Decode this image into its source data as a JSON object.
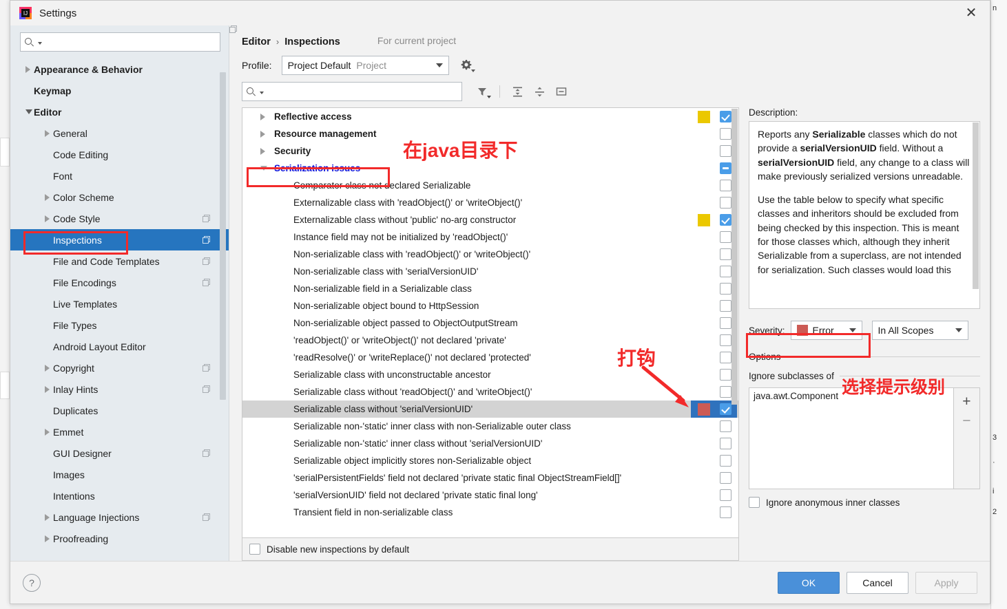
{
  "window": {
    "title": "Settings",
    "close_label": "✕"
  },
  "sidebar": {
    "search_placeholder": "",
    "search_value": "",
    "items": [
      {
        "label": "Appearance & Behavior",
        "level": 0,
        "arrow": "right",
        "copy": false,
        "selected": false
      },
      {
        "label": "Keymap",
        "level": 0,
        "arrow": "none",
        "copy": false,
        "selected": false
      },
      {
        "label": "Editor",
        "level": 0,
        "arrow": "down",
        "copy": false,
        "selected": false
      },
      {
        "label": "General",
        "level": 1,
        "arrow": "right",
        "copy": false,
        "selected": false
      },
      {
        "label": "Code Editing",
        "level": 1,
        "arrow": "none",
        "copy": false,
        "selected": false
      },
      {
        "label": "Font",
        "level": 1,
        "arrow": "none",
        "copy": false,
        "selected": false
      },
      {
        "label": "Color Scheme",
        "level": 1,
        "arrow": "right",
        "copy": false,
        "selected": false
      },
      {
        "label": "Code Style",
        "level": 1,
        "arrow": "right",
        "copy": true,
        "selected": false
      },
      {
        "label": "Inspections",
        "level": 1,
        "arrow": "none",
        "copy": true,
        "selected": true
      },
      {
        "label": "File and Code Templates",
        "level": 1,
        "arrow": "none",
        "copy": true,
        "selected": false
      },
      {
        "label": "File Encodings",
        "level": 1,
        "arrow": "none",
        "copy": true,
        "selected": false
      },
      {
        "label": "Live Templates",
        "level": 1,
        "arrow": "none",
        "copy": false,
        "selected": false
      },
      {
        "label": "File Types",
        "level": 1,
        "arrow": "none",
        "copy": false,
        "selected": false
      },
      {
        "label": "Android Layout Editor",
        "level": 1,
        "arrow": "none",
        "copy": false,
        "selected": false
      },
      {
        "label": "Copyright",
        "level": 1,
        "arrow": "right",
        "copy": true,
        "selected": false
      },
      {
        "label": "Inlay Hints",
        "level": 1,
        "arrow": "right",
        "copy": true,
        "selected": false
      },
      {
        "label": "Duplicates",
        "level": 1,
        "arrow": "none",
        "copy": false,
        "selected": false
      },
      {
        "label": "Emmet",
        "level": 1,
        "arrow": "right",
        "copy": false,
        "selected": false
      },
      {
        "label": "GUI Designer",
        "level": 1,
        "arrow": "none",
        "copy": true,
        "selected": false
      },
      {
        "label": "Images",
        "level": 1,
        "arrow": "none",
        "copy": false,
        "selected": false
      },
      {
        "label": "Intentions",
        "level": 1,
        "arrow": "none",
        "copy": false,
        "selected": false
      },
      {
        "label": "Language Injections",
        "level": 1,
        "arrow": "right",
        "copy": true,
        "selected": false
      },
      {
        "label": "Proofreading",
        "level": 1,
        "arrow": "right",
        "copy": false,
        "selected": false
      }
    ]
  },
  "breadcrumb": {
    "parent": "Editor",
    "separator": "›",
    "current": "Inspections",
    "note": "For current project"
  },
  "profile": {
    "label": "Profile:",
    "value": "Project Default",
    "scope_suffix": "Project",
    "gear_name": "gear-icon"
  },
  "tree_toolbar": {
    "search_placeholder": "",
    "search_value": "",
    "filter_label": "filter-icon",
    "expand_label": "expand-all-icon",
    "collapse_label": "collapse-all-icon",
    "reset_label": "reset-icon"
  },
  "tree": {
    "rows": [
      {
        "label": "Reflective access",
        "type": "group",
        "arrow": "right",
        "check": "on",
        "severity": "#EBC800",
        "selected": false,
        "blue": false
      },
      {
        "label": "Resource management",
        "type": "group",
        "arrow": "right",
        "check": "off",
        "severity": "",
        "selected": false,
        "blue": false
      },
      {
        "label": "Security",
        "type": "group",
        "arrow": "right",
        "check": "off",
        "severity": "",
        "selected": false,
        "blue": false
      },
      {
        "label": "Serialization issues",
        "type": "group",
        "arrow": "down",
        "check": "ind",
        "severity": "",
        "selected": false,
        "blue": true
      },
      {
        "label": "Comparator class not declared Serializable",
        "type": "leaf",
        "arrow": "none",
        "check": "off",
        "severity": "",
        "selected": false,
        "blue": false
      },
      {
        "label": "Externalizable class with 'readObject()' or 'writeObject()'",
        "type": "leaf",
        "arrow": "none",
        "check": "off",
        "severity": "",
        "selected": false,
        "blue": false
      },
      {
        "label": "Externalizable class without 'public' no-arg constructor",
        "type": "leaf",
        "arrow": "none",
        "check": "on",
        "severity": "#EBC800",
        "selected": false,
        "blue": false
      },
      {
        "label": "Instance field may not be initialized by 'readObject()'",
        "type": "leaf",
        "arrow": "none",
        "check": "off",
        "severity": "",
        "selected": false,
        "blue": false
      },
      {
        "label": "Non-serializable class with 'readObject()' or 'writeObject()'",
        "type": "leaf",
        "arrow": "none",
        "check": "off",
        "severity": "",
        "selected": false,
        "blue": false
      },
      {
        "label": "Non-serializable class with 'serialVersionUID'",
        "type": "leaf",
        "arrow": "none",
        "check": "off",
        "severity": "",
        "selected": false,
        "blue": false
      },
      {
        "label": "Non-serializable field in a Serializable class",
        "type": "leaf",
        "arrow": "none",
        "check": "off",
        "severity": "",
        "selected": false,
        "blue": false
      },
      {
        "label": "Non-serializable object bound to HttpSession",
        "type": "leaf",
        "arrow": "none",
        "check": "off",
        "severity": "",
        "selected": false,
        "blue": false
      },
      {
        "label": "Non-serializable object passed to ObjectOutputStream",
        "type": "leaf",
        "arrow": "none",
        "check": "off",
        "severity": "",
        "selected": false,
        "blue": false
      },
      {
        "label": "'readObject()' or 'writeObject()' not declared 'private'",
        "type": "leaf",
        "arrow": "none",
        "check": "off",
        "severity": "",
        "selected": false,
        "blue": false
      },
      {
        "label": "'readResolve()' or 'writeReplace()' not declared 'protected'",
        "type": "leaf",
        "arrow": "none",
        "check": "off",
        "severity": "",
        "selected": false,
        "blue": false
      },
      {
        "label": "Serializable class with unconstructable ancestor",
        "type": "leaf",
        "arrow": "none",
        "check": "off",
        "severity": "",
        "selected": false,
        "blue": false
      },
      {
        "label": "Serializable class without 'readObject()' and 'writeObject()'",
        "type": "leaf",
        "arrow": "none",
        "check": "off",
        "severity": "",
        "selected": false,
        "blue": false
      },
      {
        "label": "Serializable class without 'serialVersionUID'",
        "type": "leaf",
        "arrow": "none",
        "check": "on",
        "severity": "#CC5B55",
        "selected": true,
        "blue": false
      },
      {
        "label": "Serializable non-'static' inner class with non-Serializable outer class",
        "type": "leaf",
        "arrow": "none",
        "check": "off",
        "severity": "",
        "selected": false,
        "blue": false
      },
      {
        "label": "Serializable non-'static' inner class without 'serialVersionUID'",
        "type": "leaf",
        "arrow": "none",
        "check": "off",
        "severity": "",
        "selected": false,
        "blue": false
      },
      {
        "label": "Serializable object implicitly stores non-Serializable object",
        "type": "leaf",
        "arrow": "none",
        "check": "off",
        "severity": "",
        "selected": false,
        "blue": false
      },
      {
        "label": "'serialPersistentFields' field not declared 'private static final ObjectStreamField[]'",
        "type": "leaf",
        "arrow": "none",
        "check": "off",
        "severity": "",
        "selected": false,
        "blue": false
      },
      {
        "label": "'serialVersionUID' field not declared 'private static final long'",
        "type": "leaf",
        "arrow": "none",
        "check": "off",
        "severity": "",
        "selected": false,
        "blue": false
      },
      {
        "label": "Transient field in non-serializable class",
        "type": "leaf",
        "arrow": "none",
        "check": "off",
        "severity": "",
        "selected": false,
        "blue": false
      }
    ],
    "footer_checkbox_label": "Disable new inspections by default",
    "footer_checkbox_checked": false
  },
  "description": {
    "label": "Description:",
    "paragraph1_a": "Reports any ",
    "paragraph1_b": "Serializable",
    "paragraph1_c": " classes which do not provide a ",
    "paragraph1_d": "serialVersionUID",
    "paragraph1_e": " field. Without a ",
    "paragraph1_f": "serialVersionUID",
    "paragraph1_g": " field, any change to a class will make previously serialized versions unreadable.",
    "paragraph2": "Use the table below to specify what specific classes and inheritors should be excluded from being checked by this inspection. This is meant for those classes which, although they inherit Serializable from a superclass, are not intended for serialization. Such classes would load this"
  },
  "severity": {
    "label_pre": "Se",
    "label_mnemonic": "v",
    "label_post": "erity:",
    "value": "Error",
    "color": "#CC5B55",
    "scope_value": "In All Scopes"
  },
  "options": {
    "header": "Options",
    "ignore_subclasses_label": "Ignore subclasses of",
    "ignore_list": [
      "java.awt.Component"
    ],
    "add_label": "+",
    "remove_label": "−",
    "ignore_anonymous_label": "Ignore anonymous inner classes",
    "ignore_anonymous_checked": false
  },
  "footer": {
    "help_label": "?",
    "ok_label": "OK",
    "cancel_label": "Cancel",
    "apply_label": "Apply"
  },
  "annotations": {
    "note_java_dir": "在java目录下",
    "note_check": "打钩",
    "note_severity_level": "选择提示级别",
    "color": "#f22a2a"
  },
  "ide_background": {
    "line_a": "3",
    "line_b": "·",
    "line_c": "i",
    "line_d": "2",
    "line_e": "n"
  }
}
